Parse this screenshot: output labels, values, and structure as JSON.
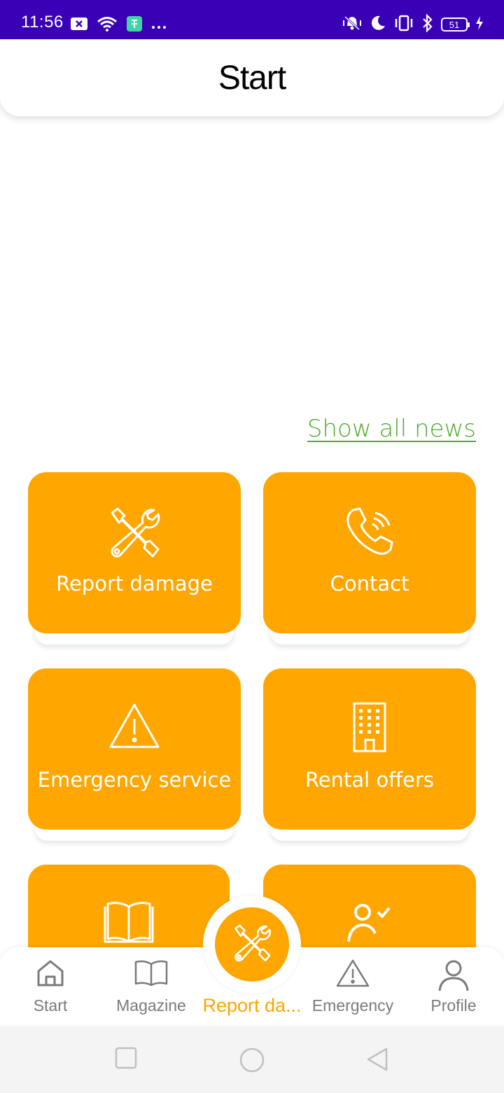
{
  "status_bar": {
    "time": "11:56",
    "battery": "51",
    "background": "#3a00b6",
    "left_icons": [
      "notification-icon",
      "wifi-icon",
      "app-icon",
      "more-dots"
    ],
    "right_icons": [
      "vibrate-icon",
      "moon-icon",
      "vibration-mode-icon",
      "bluetooth-icon",
      "battery-icon",
      "charging-icon"
    ]
  },
  "header": {
    "title": "Start"
  },
  "news": {
    "show_all_label": "Show all news",
    "color": "#4fa82e"
  },
  "tiles": [
    {
      "label": "Report damage",
      "icon": "tools-icon"
    },
    {
      "label": "Contact",
      "icon": "phone-icon"
    },
    {
      "label": "Emergency service",
      "icon": "warning-icon"
    },
    {
      "label": "Rental offers",
      "icon": "building-icon"
    },
    {
      "label": "",
      "icon": "book-icon"
    },
    {
      "label": "",
      "icon": "user-check-icon"
    }
  ],
  "bottom_nav": {
    "items": [
      {
        "label": "Start",
        "icon": "home-icon"
      },
      {
        "label": "Magazine",
        "icon": "book-icon"
      },
      {
        "label": "Report da...",
        "icon": "tools-icon",
        "active": true
      },
      {
        "label": "Emergency",
        "icon": "warning-icon"
      },
      {
        "label": "Profile",
        "icon": "person-icon"
      }
    ]
  },
  "colors": {
    "accent": "#ffa600",
    "inactive": "#7a7a7a"
  }
}
